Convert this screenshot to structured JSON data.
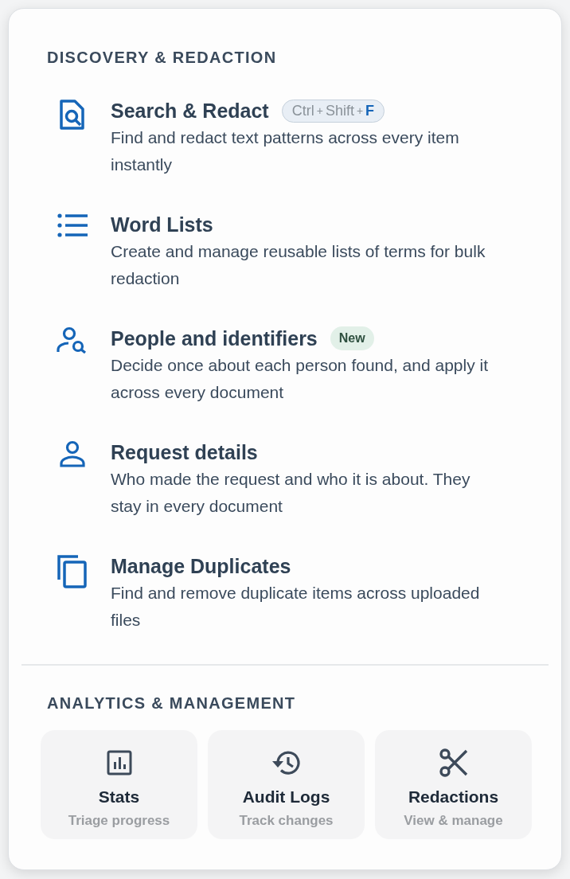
{
  "menu": {
    "sections": [
      {
        "heading": "DISCOVERY & REDACTION",
        "kind": "list",
        "items": [
          {
            "kind": "doc-search",
            "title": "Search & Redact",
            "description": "Find and redact text patterns across every item instantly",
            "shortcut": [
              {
                "text": "Ctrl",
                "kind": "key"
              },
              {
                "text": "+",
                "kind": "sep"
              },
              {
                "text": "Shift",
                "kind": "key"
              },
              {
                "text": "+",
                "kind": "sep"
              },
              {
                "text": "F",
                "kind": "main"
              }
            ]
          },
          {
            "kind": "list",
            "title": "Word Lists",
            "description": "Create and manage reusable lists of terms for bulk redaction"
          },
          {
            "kind": "person-search",
            "title": "People and identifiers",
            "badge": "New",
            "description": "Decide once about each person found, and apply it across every document"
          },
          {
            "kind": "person",
            "title": "Request details",
            "description": "Who made the request and who it is about. They stay in every document"
          },
          {
            "kind": "copy",
            "title": "Manage Duplicates",
            "description": "Find and remove duplicate items across uploaded files"
          }
        ]
      },
      {
        "heading": "ANALYTICS & MANAGEMENT",
        "kind": "cards",
        "items": [
          {
            "kind": "chart",
            "title": "Stats",
            "description": "Triage progress"
          },
          {
            "kind": "history",
            "title": "Audit Logs",
            "description": "Track changes"
          },
          {
            "kind": "scissors",
            "title": "Redactions",
            "description": "View & manage"
          }
        ]
      }
    ]
  }
}
